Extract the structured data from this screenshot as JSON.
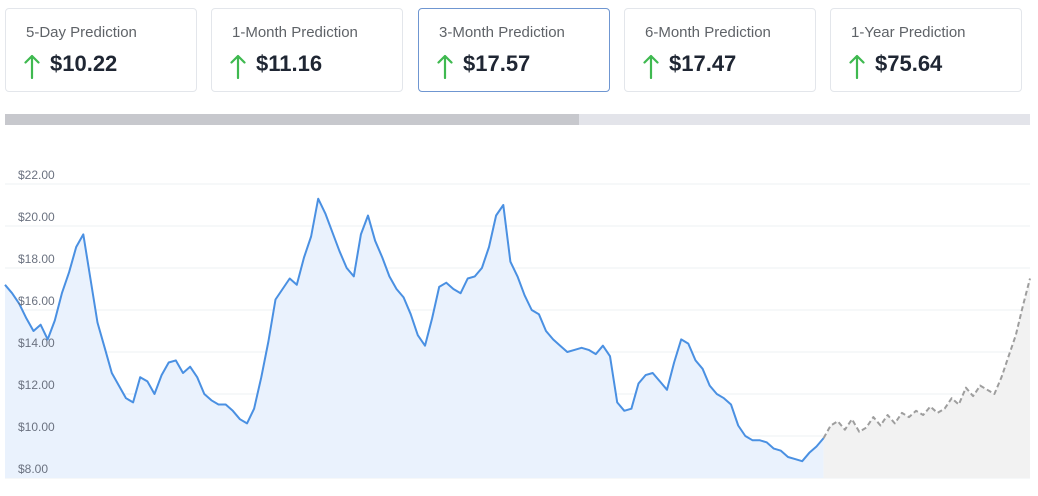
{
  "cards": [
    {
      "label": "5-Day Prediction",
      "value": "$10.22",
      "icon": "arrow-up-icon",
      "active": false
    },
    {
      "label": "1-Month Prediction",
      "value": "$11.16",
      "icon": "arrow-up-icon",
      "active": false
    },
    {
      "label": "3-Month Prediction",
      "value": "$17.57",
      "icon": "arrow-up-icon",
      "active": true
    },
    {
      "label": "6-Month Prediction",
      "value": "$17.47",
      "icon": "arrow-up-icon",
      "active": false
    },
    {
      "label": "1-Year Prediction",
      "value": "$75.64",
      "icon": "arrow-up-icon",
      "active": false
    }
  ],
  "scrollbar": {
    "visible_fraction": 0.56
  },
  "colors": {
    "accent_up": "#3fb950",
    "history_line": "#4a90e2",
    "history_fill": "#eaf2fd",
    "forecast_line": "#9e9e9e",
    "forecast_fill": "#f2f2f2",
    "active_border": "#6f96d1"
  },
  "chart_data": {
    "type": "line",
    "title": "",
    "xlabel": "",
    "ylabel": "",
    "ylim": [
      8,
      22
    ],
    "yticks": [
      8,
      10,
      12,
      14,
      16,
      18,
      20,
      22
    ],
    "ytick_labels": [
      "$8.00",
      "$10.00",
      "$12.00",
      "$14.00",
      "$16.00",
      "$18.00",
      "$20.00",
      "$22.00"
    ],
    "grid": true,
    "series": [
      {
        "style": "solid",
        "values": [
          17.2,
          16.8,
          16.3,
          15.6,
          15.0,
          15.3,
          14.6,
          15.5,
          16.8,
          17.8,
          19.0,
          19.6,
          17.5,
          15.4,
          14.2,
          13.0,
          12.4,
          11.8,
          11.6,
          12.8,
          12.6,
          12.0,
          12.9,
          13.5,
          13.6,
          13.0,
          13.3,
          12.8,
          12.0,
          11.7,
          11.5,
          11.5,
          11.2,
          10.8,
          10.6,
          11.3,
          12.8,
          14.5,
          16.5,
          17.0,
          17.5,
          17.2,
          18.5,
          19.5,
          21.3,
          20.6,
          19.7,
          18.8,
          18.0,
          17.6,
          19.6,
          20.5,
          19.3,
          18.5,
          17.6,
          17.0,
          16.6,
          15.8,
          14.8,
          14.3,
          15.6,
          17.1,
          17.3,
          17.0,
          16.8,
          17.5,
          17.6,
          18.0,
          19.0,
          20.5,
          21.0,
          18.3,
          17.6,
          16.7,
          16.0,
          15.8,
          15.0,
          14.6,
          14.3,
          14.0,
          14.1,
          14.2,
          14.1,
          13.9,
          14.3,
          13.8,
          11.6,
          11.2,
          11.3,
          12.5,
          12.9,
          13.0,
          12.6,
          12.2,
          13.5,
          14.6,
          14.4,
          13.6,
          13.2,
          12.4,
          12.0,
          11.8,
          11.5,
          10.5,
          10.0,
          9.8,
          9.8,
          9.7,
          9.4,
          9.3,
          9.0,
          8.9,
          8.8,
          9.2,
          9.5,
          9.9
        ]
      },
      {
        "style": "dashed",
        "values": [
          9.9,
          10.5,
          10.7,
          10.3,
          10.8,
          10.2,
          10.4,
          10.9,
          10.5,
          11.0,
          10.6,
          11.1,
          10.9,
          11.2,
          11.0,
          11.4,
          11.1,
          11.3,
          11.8,
          11.5,
          12.3,
          11.9,
          12.4,
          12.2,
          12.0,
          12.8,
          13.8,
          14.8,
          16.2,
          17.5
        ]
      }
    ]
  }
}
